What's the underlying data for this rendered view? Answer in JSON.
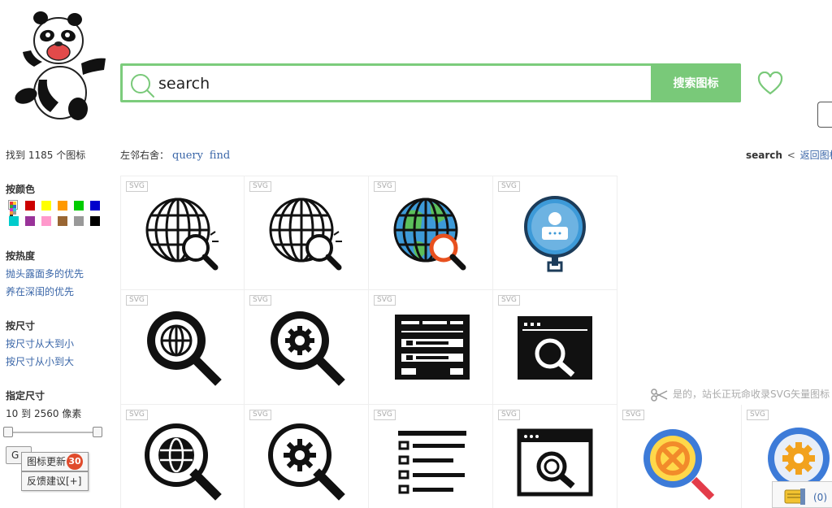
{
  "search": {
    "value": "search",
    "button_label": "搜索图标"
  },
  "results": {
    "prefix": "找到",
    "count": "1185",
    "suffix": "个图标"
  },
  "related": {
    "label": "左邻右舍：",
    "links": [
      "query",
      "find"
    ]
  },
  "breadcrumb": {
    "current": "search",
    "separator": "<",
    "back_label": "返回图标"
  },
  "sidebar": {
    "color_title": "按颜色",
    "colors": [
      "#cc0000",
      "#ffff00",
      "#ff9900",
      "#00cc00",
      "#0000cc",
      "#00cccc",
      "#993399",
      "#ff99cc",
      "#996633",
      "#999999",
      "#000000"
    ],
    "heat_title": "按热度",
    "heat_options": [
      "抛头露面多的优先",
      "养在深闺的优先"
    ],
    "size_title": "按尺寸",
    "size_options": [
      "按尺寸从大到小",
      "按尺寸从小到大"
    ],
    "range_title": "指定尺寸",
    "range_from": "10",
    "range_to_word": "到",
    "range_to": "2560",
    "range_unit": "像素",
    "go_label": "G"
  },
  "floating": {
    "updates_label": "图标更新",
    "updates_count": "30",
    "feedback_label": "反馈建议[+]"
  },
  "icons": {
    "tag": "SVG"
  },
  "notice": {
    "text": "是的，站长正玩命收录SVG矢量图标"
  },
  "mail": {
    "count": "(0)"
  }
}
